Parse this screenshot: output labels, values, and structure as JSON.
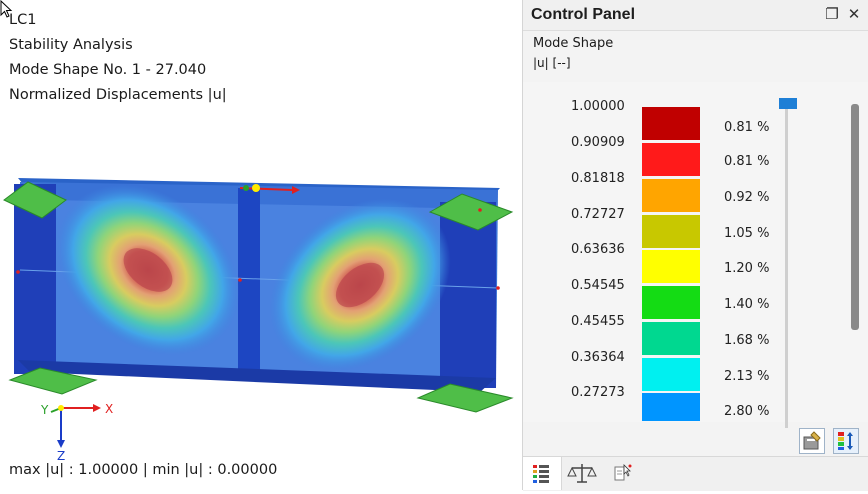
{
  "viewport": {
    "info_lines": [
      "LC1",
      "Stability Analysis",
      "Mode Shape No. 1 - 27.040",
      "Normalized Displacements |u|"
    ],
    "footer": "max |u| : 1.00000 | min |u| : 0.00000",
    "axis_labels": {
      "x": "X",
      "y": "Y",
      "z": "Z"
    }
  },
  "panel": {
    "title": "Control Panel",
    "float_icon": "restore-window-icon",
    "close_icon": "close-icon",
    "mode_shape_title": "Mode Shape",
    "unit_label": "|u| [--]",
    "legend": {
      "values": [
        "1.00000",
        "0.90909",
        "0.81818",
        "0.72727",
        "0.63636",
        "0.54545",
        "0.45455",
        "0.36364",
        "0.27273"
      ],
      "colors": [
        "#c00000",
        "#ff1a1a",
        "#ffa500",
        "#c8c800",
        "#ffff00",
        "#14dc14",
        "#00d890",
        "#00f0f0",
        "#0095ff"
      ],
      "percents": [
        "0.81 %",
        "0.81 %",
        "0.92 %",
        "1.05 %",
        "1.20 %",
        "1.40 %",
        "1.68 %",
        "2.13 %",
        "2.80 %"
      ]
    },
    "buttons": {
      "settings_icon": "display-settings-icon",
      "legend_icon": "color-scale-icon"
    },
    "tabs": [
      {
        "name": "tab-color-scale",
        "icon": "color-list-icon"
      },
      {
        "name": "tab-balance",
        "icon": "balance-scale-icon"
      },
      {
        "name": "tab-filter",
        "icon": "filter-cursor-icon"
      }
    ]
  }
}
